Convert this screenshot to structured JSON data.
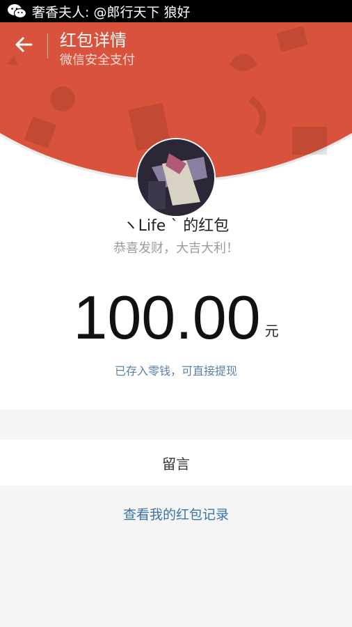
{
  "status_bar": {
    "notification": "奢香夫人: @郎行天下 狼好",
    "icon": "wechat-icon"
  },
  "nav": {
    "back_icon": "arrow-left-icon",
    "title": "红包详情",
    "subtitle": "微信安全支付"
  },
  "envelope": {
    "sender": "ヽLife ˋ 的红包",
    "greeting": "恭喜发财，大吉大利！",
    "amount": "100.00",
    "currency": "元",
    "deposit_text": "已存入零钱，可直接提现"
  },
  "message": {
    "label": "留言"
  },
  "records": {
    "link": "查看我的红包记录"
  },
  "colors": {
    "header_red": "#d9533c",
    "link_blue": "#3a73a8",
    "background": "#f5f5f5"
  }
}
